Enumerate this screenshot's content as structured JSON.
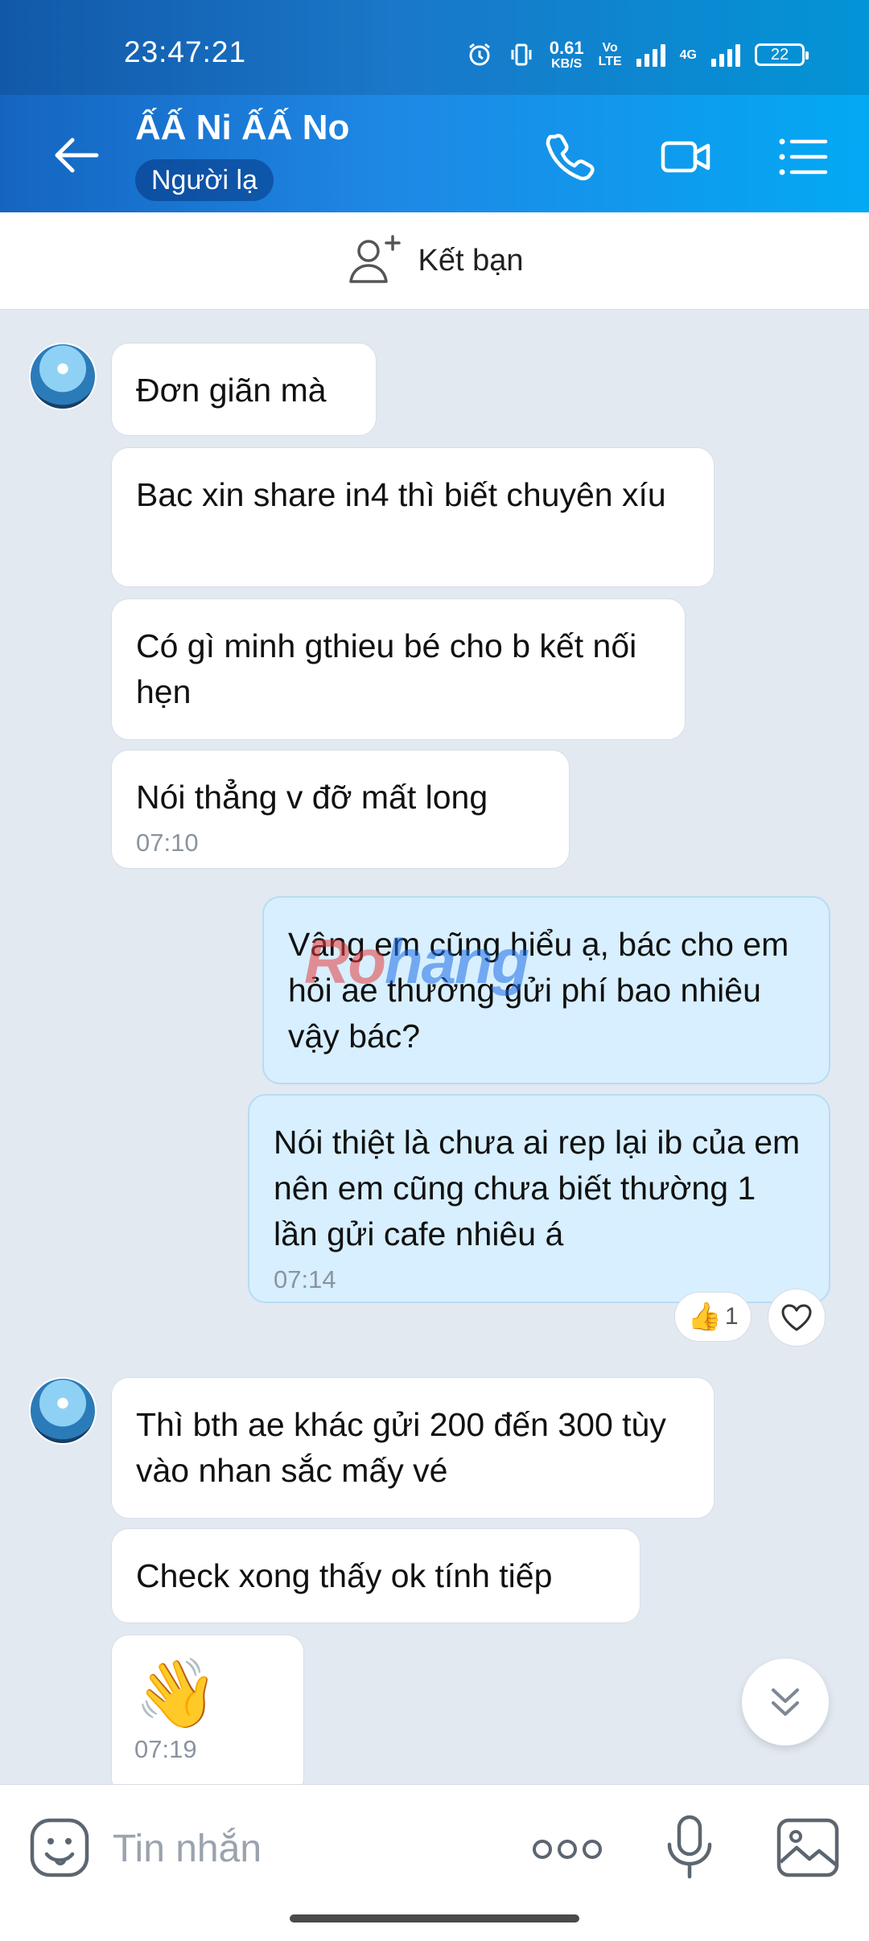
{
  "status_bar": {
    "time": "23:47:21",
    "net_speed": "0.61",
    "net_unit": "KB/S",
    "volte": "Vo",
    "volte2": "LTE",
    "network": "4G",
    "battery": "22"
  },
  "header": {
    "contact_name": "ẤẤ Ni ẤẤ No",
    "badge": "Người lạ"
  },
  "friend_bar": {
    "label": "Kết bạn"
  },
  "messages": [
    {
      "text": "Đơn giãn mà"
    },
    {
      "text": "Bac xin share in4 thì biết chuyên xíu"
    },
    {
      "text": "Có gì minh gthieu bé cho b kết nối hẹn"
    },
    {
      "text": "Nói thẳng v đỡ mất long",
      "time": "07:10"
    },
    {
      "text": "Vâng em cũng hiểu ạ, bác cho em hỏi ae thường gửi phí bao nhiêu vậy bác?"
    },
    {
      "text": "Nói thiệt là chưa ai rep lại ib của em nên em cũng chưa biết thường 1 lần gửi cafe nhiêu á",
      "time": "07:14"
    },
    {
      "text": "Thì bth ae khác gửi 200 đến 300 tùy vào nhan sắc mấy vé"
    },
    {
      "text": "Check xong thấy ok tính tiếp"
    },
    {
      "emoji": "👋",
      "time": "07:19"
    }
  ],
  "reaction": {
    "count": "1"
  },
  "watermark": {
    "part1": "Ro",
    "part2": "hang"
  },
  "input": {
    "placeholder": "Tin nhắn"
  },
  "colors": {
    "header_start": "#1565c0",
    "header_end": "#03a9f4",
    "chat_bg": "#e2e9f1",
    "my_bubble": "#d7efff",
    "their_bubble": "#ffffff"
  }
}
